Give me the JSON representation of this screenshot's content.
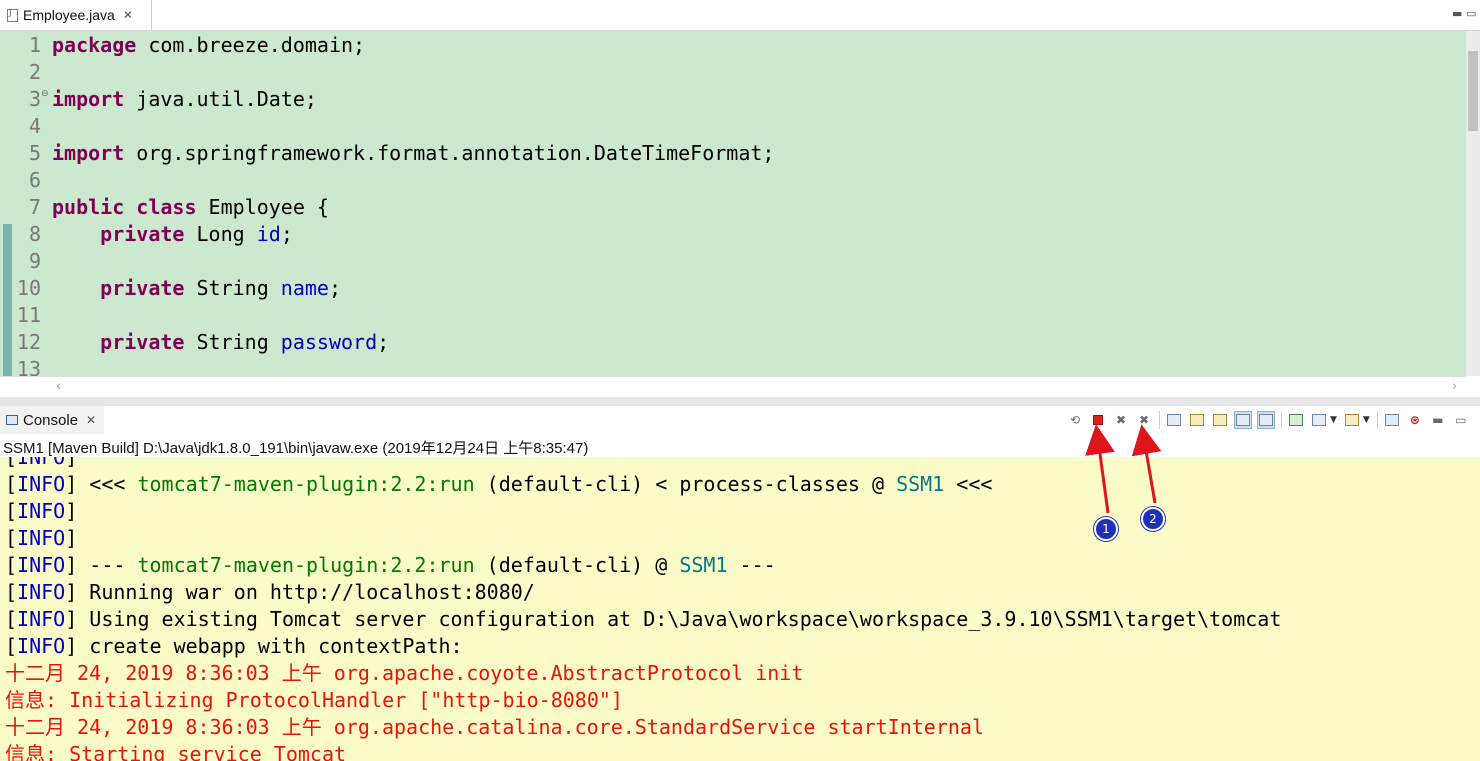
{
  "editor": {
    "tab": {
      "label": "Employee.java",
      "close": "✕",
      "icon": "java-file-icon"
    },
    "window_controls": {
      "minimize": "▬",
      "maximize": "▭"
    },
    "lines": [
      {
        "number": "1",
        "segments": [
          {
            "t": "package",
            "c": "kw"
          },
          {
            "t": " com.breeze.domain;"
          }
        ]
      },
      {
        "number": "2",
        "segments": []
      },
      {
        "number": "3",
        "fold": "⊖",
        "segments": [
          {
            "t": "import",
            "c": "kw"
          },
          {
            "t": " java.util.Date;"
          }
        ]
      },
      {
        "number": "4",
        "segments": []
      },
      {
        "number": "5",
        "segments": [
          {
            "t": "import",
            "c": "kw"
          },
          {
            "t": " org.springframework.format.annotation.DateTimeFormat;"
          }
        ]
      },
      {
        "number": "6",
        "segments": []
      },
      {
        "number": "7",
        "segments": [
          {
            "t": "public",
            "c": "kw"
          },
          {
            "t": " "
          },
          {
            "t": "class",
            "c": "kw"
          },
          {
            "t": " Employee {"
          }
        ]
      },
      {
        "number": "8",
        "segments": [
          {
            "t": "    "
          },
          {
            "t": "private",
            "c": "kw"
          },
          {
            "t": " Long "
          },
          {
            "t": "id",
            "c": "fld"
          },
          {
            "t": ";"
          }
        ]
      },
      {
        "number": "9",
        "segments": []
      },
      {
        "number": "10",
        "segments": [
          {
            "t": "    "
          },
          {
            "t": "private",
            "c": "kw"
          },
          {
            "t": " String "
          },
          {
            "t": "name",
            "c": "fld"
          },
          {
            "t": ";"
          }
        ]
      },
      {
        "number": "11",
        "segments": []
      },
      {
        "number": "12",
        "segments": [
          {
            "t": "    "
          },
          {
            "t": "private",
            "c": "kw"
          },
          {
            "t": " String "
          },
          {
            "t": "password",
            "c": "fld"
          },
          {
            "t": ";"
          }
        ]
      },
      {
        "number": "13",
        "segments": []
      }
    ],
    "colors": {
      "background": "#cce8cf",
      "keyword": "#7f0055",
      "field": "#0000c0"
    }
  },
  "console": {
    "tab": {
      "label": "Console",
      "close": "✕",
      "icon": "console-icon"
    },
    "process_label": "SSM1 [Maven Build] D:\\Java\\jdk1.8.0_191\\bin\\javaw.exe (2019年12月24日 上午8:35:47)",
    "toolbar": [
      {
        "name": "pin-console-icon",
        "glyph": "⟲"
      },
      {
        "name": "terminate-icon",
        "glyph": ""
      },
      {
        "name": "remove-launch-icon",
        "glyph": "✖"
      },
      {
        "name": "remove-all-terminated-icon",
        "glyph": "✖"
      },
      {
        "name": "clear-console-icon",
        "glyph": ""
      },
      {
        "name": "scroll-lock-icon",
        "glyph": ""
      },
      {
        "name": "word-wrap-icon",
        "glyph": ""
      },
      {
        "name": "show-on-stdout-icon",
        "glyph": ""
      },
      {
        "name": "show-on-stderr-icon",
        "glyph": ""
      },
      {
        "name": "pin-icon",
        "glyph": ""
      },
      {
        "name": "display-selected-console-icon",
        "glyph": ""
      },
      {
        "name": "open-console-icon",
        "glyph": ""
      },
      {
        "name": "copy-icon",
        "glyph": ""
      },
      {
        "name": "maven-icon",
        "glyph": ""
      },
      {
        "name": "minimize-icon",
        "glyph": "▬"
      },
      {
        "name": "maximize-icon",
        "glyph": "▭"
      }
    ],
    "lines": [
      [
        {
          "t": "[",
          "c": "blk"
        },
        {
          "t": "INFO",
          "c": "blue"
        },
        {
          "t": "]",
          "c": "blk"
        }
      ],
      [
        {
          "t": "[",
          "c": "blk"
        },
        {
          "t": "INFO",
          "c": "blue"
        },
        {
          "t": "] <<< ",
          "c": "blk"
        },
        {
          "t": "tomcat7-maven-plugin:2.2:run",
          "c": "grn"
        },
        {
          "t": " (default-cli) < process-classes @ ",
          "c": "blk"
        },
        {
          "t": "SSM1",
          "c": "teal"
        },
        {
          "t": " <<<",
          "c": "blk"
        }
      ],
      [
        {
          "t": "[",
          "c": "blk"
        },
        {
          "t": "INFO",
          "c": "blue"
        },
        {
          "t": "]",
          "c": "blk"
        }
      ],
      [
        {
          "t": "[",
          "c": "blk"
        },
        {
          "t": "INFO",
          "c": "blue"
        },
        {
          "t": "]",
          "c": "blk"
        }
      ],
      [
        {
          "t": "[",
          "c": "blk"
        },
        {
          "t": "INFO",
          "c": "blue"
        },
        {
          "t": "] --- ",
          "c": "blk"
        },
        {
          "t": "tomcat7-maven-plugin:2.2:run",
          "c": "grn"
        },
        {
          "t": " (default-cli) @ ",
          "c": "blk"
        },
        {
          "t": "SSM1",
          "c": "teal"
        },
        {
          "t": " ---",
          "c": "blk"
        }
      ],
      [
        {
          "t": "[",
          "c": "blk"
        },
        {
          "t": "INFO",
          "c": "blue"
        },
        {
          "t": "] Running war on http://localhost:8080/",
          "c": "blk"
        }
      ],
      [
        {
          "t": "[",
          "c": "blk"
        },
        {
          "t": "INFO",
          "c": "blue"
        },
        {
          "t": "] Using existing Tomcat server configuration at D:\\Java\\workspace\\workspace_3.9.10\\SSM1\\target\\tomcat",
          "c": "blk"
        }
      ],
      [
        {
          "t": "[",
          "c": "blk"
        },
        {
          "t": "INFO",
          "c": "blue"
        },
        {
          "t": "] create webapp with contextPath:",
          "c": "blk"
        }
      ],
      [
        {
          "t": "十二月 24, 2019 8:36:03 上午 org.apache.coyote.AbstractProtocol init",
          "c": "red"
        }
      ],
      [
        {
          "t": "信息: Initializing ProtocolHandler [\"http-bio-8080\"]",
          "c": "red"
        }
      ],
      [
        {
          "t": "十二月 24, 2019 8:36:03 上午 org.apache.catalina.core.StandardService startInternal",
          "c": "red"
        }
      ],
      [
        {
          "t": "信息: Starting service Tomcat",
          "c": "red"
        }
      ]
    ],
    "colors": {
      "background": "#fbfbc8",
      "info": "#0000c8",
      "plugin": "#007a00",
      "project": "#007a88",
      "stderr": "#e8140c"
    }
  },
  "annotations": [
    {
      "label": "1",
      "target": "terminate-icon"
    },
    {
      "label": "2",
      "target": "remove-all-terminated-icon"
    }
  ],
  "annotation_color": "#e0141c"
}
